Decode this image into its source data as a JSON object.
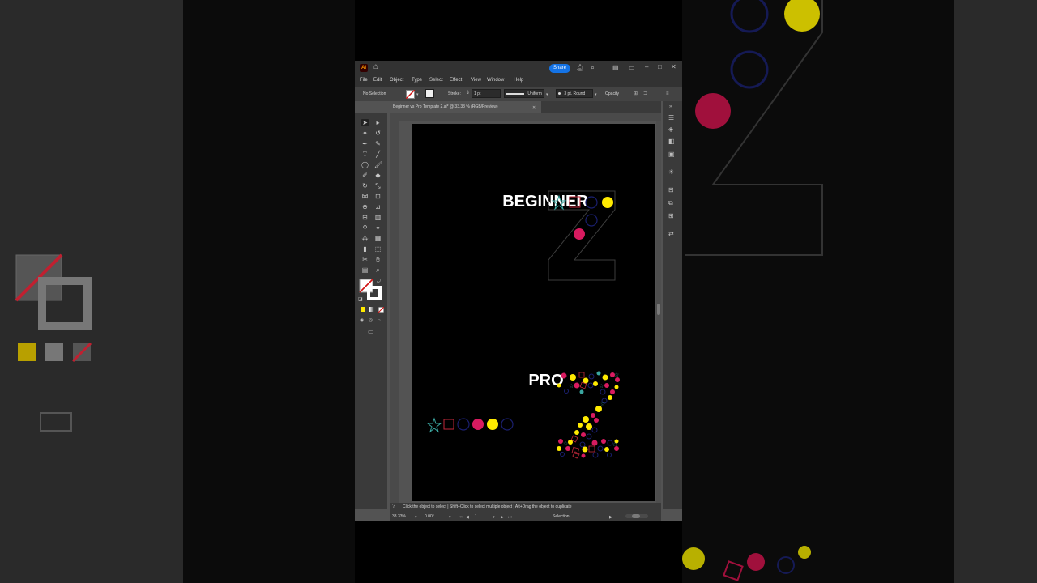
{
  "app": {
    "logo": "Ai",
    "share_label": "Share",
    "menu": [
      "File",
      "Edit",
      "Object",
      "Type",
      "Select",
      "Effect",
      "View",
      "Window",
      "Help"
    ],
    "control": {
      "selection": "No Selection",
      "stroke_label": "Stroke:",
      "stroke_weight": "1 pt",
      "profile": "Uniform",
      "brush": "3 pt. Round",
      "opacity_label": "Opacity"
    },
    "document_tab": "Beginner vs Pro Template 2.ai* @ 33.33 % (RGB/Preview)",
    "status_hint": "Click the object to select  |  Shift+Click to select multiple object  |  Alt+Drag the object to duplicate",
    "zoom": "33.33%",
    "rotation": "0.00°",
    "artboard_number": "1",
    "tool_status": "Selection"
  },
  "artboard": {
    "heading_top": "BEGINNER",
    "heading_bottom": "PRO"
  },
  "colors": {
    "teal": "#3aa6a0",
    "red_outline": "#c0283a",
    "navy": "#1a1f6e",
    "magenta": "#d81b60",
    "yellow": "#ffea00",
    "accent_blue": "#1473e6"
  },
  "icons": [
    "home-icon",
    "bell-icon",
    "search-icon",
    "minimize-icon",
    "maximize-icon",
    "close-icon",
    "help-icon"
  ]
}
